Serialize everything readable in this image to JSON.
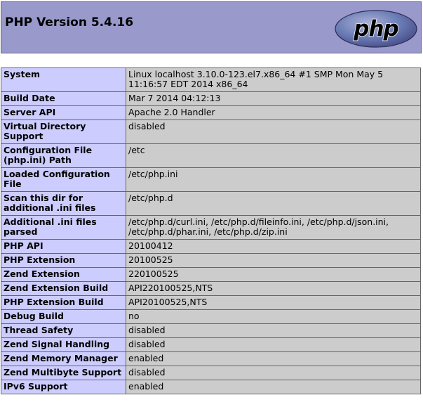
{
  "header": {
    "title": "PHP Version 5.4.16",
    "logo_text": "php"
  },
  "colors": {
    "header_bg": "#9999cc",
    "key_cell_bg": "#ccccff",
    "value_cell_bg": "#cccccc",
    "border": "#666666",
    "logo_fill": "#6c7eb7"
  },
  "rows": [
    {
      "key": "System",
      "value": "Linux localhost 3.10.0-123.el7.x86_64 #1 SMP Mon May 5 11:16:57 EDT 2014 x86_64"
    },
    {
      "key": "Build Date",
      "value": "Mar 7 2014 04:12:13"
    },
    {
      "key": "Server API",
      "value": "Apache 2.0 Handler"
    },
    {
      "key": "Virtual Directory Support",
      "value": "disabled"
    },
    {
      "key": "Configuration File (php.ini) Path",
      "value": "/etc"
    },
    {
      "key": "Loaded Configuration File",
      "value": "/etc/php.ini"
    },
    {
      "key": "Scan this dir for additional .ini files",
      "value": "/etc/php.d"
    },
    {
      "key": "Additional .ini files parsed",
      "value": "/etc/php.d/curl.ini, /etc/php.d/fileinfo.ini, /etc/php.d/json.ini, /etc/php.d/phar.ini, /etc/php.d/zip.ini"
    },
    {
      "key": "PHP API",
      "value": "20100412"
    },
    {
      "key": "PHP Extension",
      "value": "20100525"
    },
    {
      "key": "Zend Extension",
      "value": "220100525"
    },
    {
      "key": "Zend Extension Build",
      "value": "API220100525,NTS"
    },
    {
      "key": "PHP Extension Build",
      "value": "API20100525,NTS"
    },
    {
      "key": "Debug Build",
      "value": "no"
    },
    {
      "key": "Thread Safety",
      "value": "disabled"
    },
    {
      "key": "Zend Signal Handling",
      "value": "disabled"
    },
    {
      "key": "Zend Memory Manager",
      "value": "enabled"
    },
    {
      "key": "Zend Multibyte Support",
      "value": "disabled"
    },
    {
      "key": "IPv6 Support",
      "value": "enabled"
    }
  ]
}
